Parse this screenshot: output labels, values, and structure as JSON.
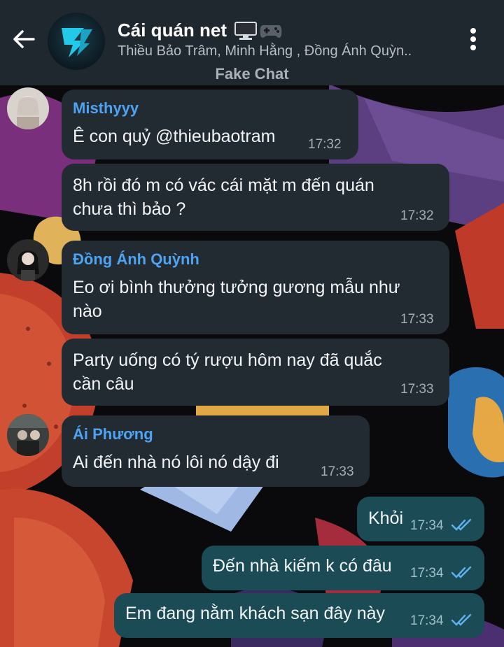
{
  "header": {
    "title": "Cái quán net",
    "subtitle": "Thiều Bảo Trâm, Minh Hằng , Đồng Ánh Quỳn..",
    "watermark": "Fake Chat"
  },
  "messages": [
    {
      "sender": "Misthyyy",
      "text": "Ê con quỷ @thieubaotram",
      "time": "17:32"
    },
    {
      "text_line1": "8h rồi đó m có vác cái mặt m đến quán",
      "text_line2": "chưa thì bảo ?",
      "time": "17:32"
    },
    {
      "sender": "Đồng Ánh Quỳnh",
      "text_line1": "Eo ơi bình thưởng tưởng gương mẫu như",
      "text_line2": "nào",
      "time": "17:33"
    },
    {
      "text_line1": "Party uống có tý rượu hôm nay đã quắc",
      "text_line2": "cần câu",
      "time": "17:33"
    },
    {
      "sender": "Ái Phương",
      "text": "Ai đến nhà nó lôi nó dậy đi",
      "time": "17:33"
    }
  ],
  "outgoing": [
    {
      "text": "Khỏi",
      "time": "17:34"
    },
    {
      "text": "Đến nhà kiếm k có đâu",
      "time": "17:34"
    },
    {
      "text": "Em đang nằm khách sạn đây này",
      "time": "17:34"
    }
  ],
  "colors": {
    "header_bg": "#1f272f",
    "incoming_bubble": "#222a32",
    "outgoing_bubble": "#1b4b55",
    "sender_name": "#4ea3f2",
    "read_ticks": "#5fb0f0"
  },
  "icons": {
    "back": "arrow-left-icon",
    "more": "more-vertical-icon",
    "computer": "desktop-computer-icon",
    "gamepad": "game-controller-icon",
    "read": "double-check-icon"
  }
}
